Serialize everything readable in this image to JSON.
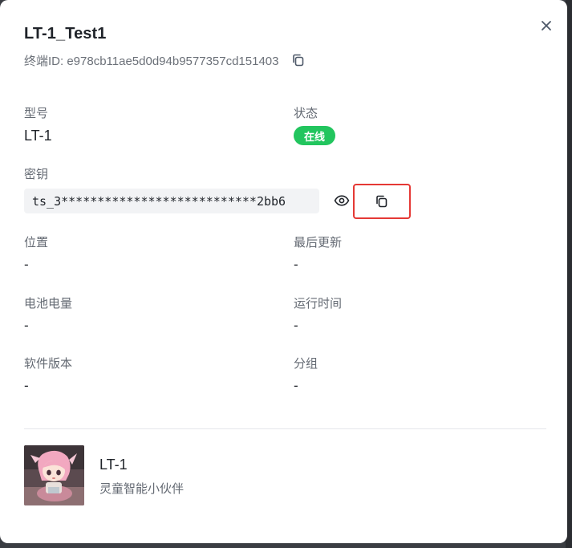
{
  "modal": {
    "title": "LT-1_Test1",
    "terminal_id_text": "终端ID: e978cb11ae5d0d94b9577357cd151403"
  },
  "fields": {
    "model": {
      "label": "型号",
      "value": "LT-1"
    },
    "status": {
      "label": "状态",
      "value": "在线",
      "color": "#22c55e"
    },
    "secret": {
      "label": "密钥",
      "value": "ts_3***************************2bb6"
    },
    "location": {
      "label": "位置",
      "value": "-"
    },
    "last_update": {
      "label": "最后更新",
      "value": "-"
    },
    "battery": {
      "label": "电池电量",
      "value": "-"
    },
    "uptime": {
      "label": "运行时间",
      "value": "-"
    },
    "software_version": {
      "label": "软件版本",
      "value": "-"
    },
    "group": {
      "label": "分组",
      "value": "-"
    }
  },
  "device": {
    "name": "LT-1",
    "description": "灵童智能小伙伴"
  },
  "icons": {
    "close": "close-icon",
    "copy": "copy-icon",
    "eye": "eye-icon"
  },
  "colors": {
    "highlight_border": "#e53935"
  }
}
